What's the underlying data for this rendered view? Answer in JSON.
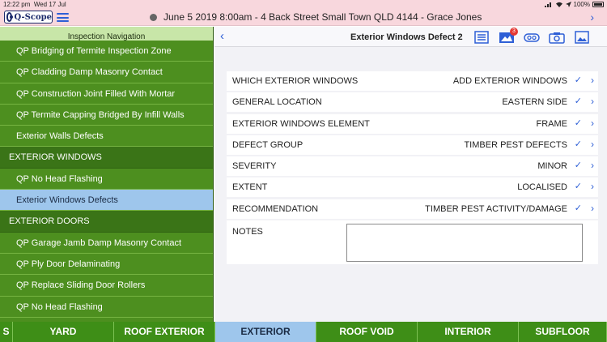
{
  "statusbar": {
    "time": "12:22 pm",
    "date": "Wed 17 Jul",
    "battery": "100%"
  },
  "topbar": {
    "logo_text": "Q-Scope",
    "title": "June 5 2019 8:00am -  4 Back Street Small Town QLD 4144 - Grace Jones"
  },
  "sidebar": {
    "header": "Inspection Navigation",
    "items": [
      {
        "label": "QP Bridging of Termite Inspection Zone",
        "kind": "item"
      },
      {
        "label": "QP Cladding Damp Masonry Contact",
        "kind": "item"
      },
      {
        "label": "QP Construction Joint Filled With Mortar",
        "kind": "item"
      },
      {
        "label": "QP Termite Capping Bridged By Infill Walls",
        "kind": "item"
      },
      {
        "label": "Exterior Walls Defects",
        "kind": "item"
      },
      {
        "label": "EXTERIOR WINDOWS",
        "kind": "section"
      },
      {
        "label": "QP No Head Flashing",
        "kind": "item"
      },
      {
        "label": "Exterior Windows Defects",
        "kind": "active"
      },
      {
        "label": "EXTERIOR DOORS",
        "kind": "section"
      },
      {
        "label": "QP Garage Jamb Damp Masonry Contact",
        "kind": "item"
      },
      {
        "label": "QP Ply Door Delaminating",
        "kind": "item"
      },
      {
        "label": "QP Replace Sliding Door Rollers",
        "kind": "item"
      },
      {
        "label": "QP No Head Flashing",
        "kind": "item"
      }
    ]
  },
  "pane": {
    "title": "Exterior Windows Defect 2",
    "photo_badge": "3",
    "icons": [
      "list-icon",
      "image-gallery-icon",
      "link-icon",
      "camera-icon",
      "photo-import-icon"
    ],
    "rows": [
      {
        "label": "WHICH EXTERIOR WINDOWS",
        "value": "ADD EXTERIOR WINDOWS"
      },
      {
        "label": "GENERAL LOCATION",
        "value": "EASTERN SIDE"
      },
      {
        "label": "EXTERIOR WINDOWS ELEMENT",
        "value": "FRAME"
      },
      {
        "label": "DEFECT GROUP",
        "value": "TIMBER PEST DEFECTS"
      },
      {
        "label": "SEVERITY",
        "value": "MINOR"
      },
      {
        "label": "EXTENT",
        "value": "LOCALISED"
      },
      {
        "label": "RECOMMENDATION",
        "value": "TIMBER PEST ACTIVITY/DAMAGE"
      }
    ],
    "notes_label": "NOTES",
    "notes_value": ""
  },
  "tabs": [
    {
      "label": "S",
      "active": false
    },
    {
      "label": "YARD",
      "active": false
    },
    {
      "label": "ROOF EXTERIOR",
      "active": false
    },
    {
      "label": "EXTERIOR",
      "active": true
    },
    {
      "label": "ROOF VOID",
      "active": false
    },
    {
      "label": "INTERIOR",
      "active": false
    },
    {
      "label": "SUBFLOOR",
      "active": false
    }
  ],
  "colors": {
    "accent": "#2e5fd6",
    "sidebar_green": "#4d8f1f",
    "section_green": "#3a7417",
    "active_blue": "#9ec6ec",
    "topbar_pink": "#f8d7dd"
  }
}
